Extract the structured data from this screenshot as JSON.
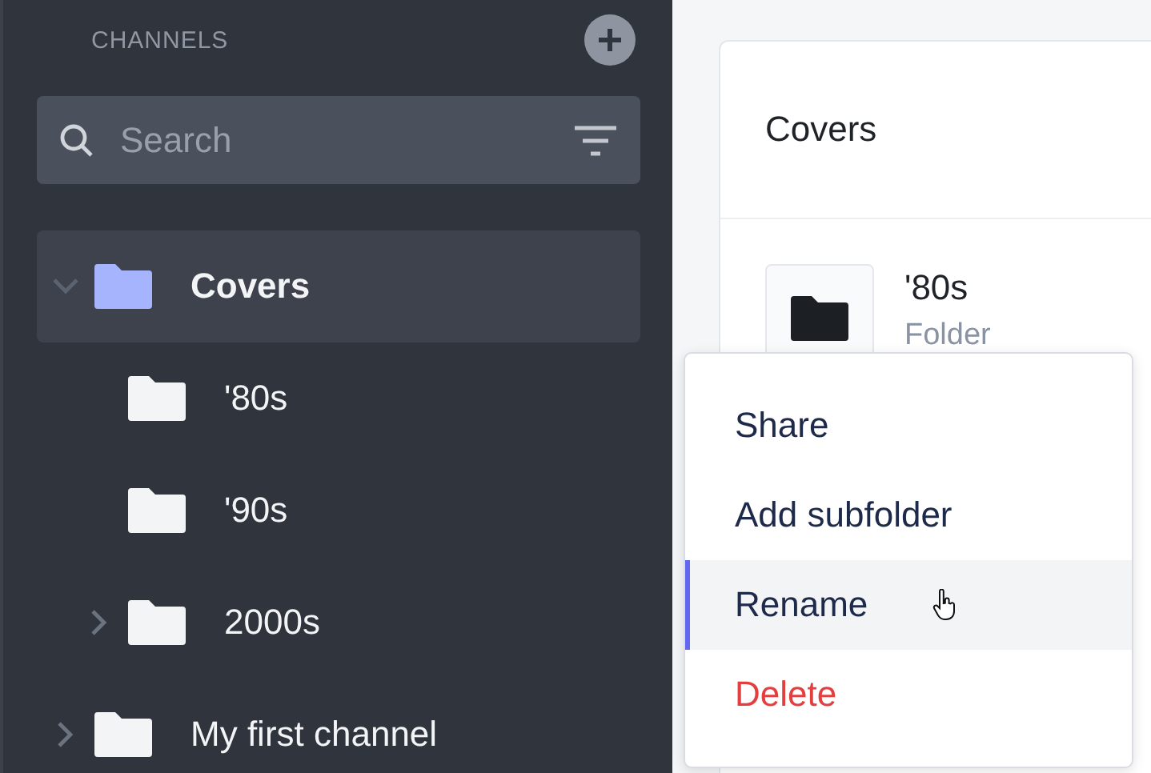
{
  "sidebar": {
    "heading": "CHANNELS",
    "search": {
      "placeholder": "Search"
    },
    "tree": [
      {
        "label": "Covers",
        "selected": true,
        "expanded": true,
        "children": [
          {
            "label": "'80s",
            "selected": false
          },
          {
            "label": "'90s",
            "selected": false
          },
          {
            "label": "2000s",
            "selected": false,
            "expanded": false
          }
        ]
      },
      {
        "label": "My first channel",
        "selected": false,
        "expanded": false
      }
    ]
  },
  "main": {
    "title": "Covers",
    "items": [
      {
        "name": "'80s",
        "type": "Folder"
      }
    ]
  },
  "context_menu": {
    "items": [
      {
        "label": "Share",
        "kind": "default",
        "selected": false
      },
      {
        "label": "Add subfolder",
        "kind": "default",
        "selected": false
      },
      {
        "label": "Rename",
        "kind": "default",
        "selected": true
      },
      {
        "label": "Delete",
        "kind": "danger",
        "selected": false
      }
    ]
  }
}
